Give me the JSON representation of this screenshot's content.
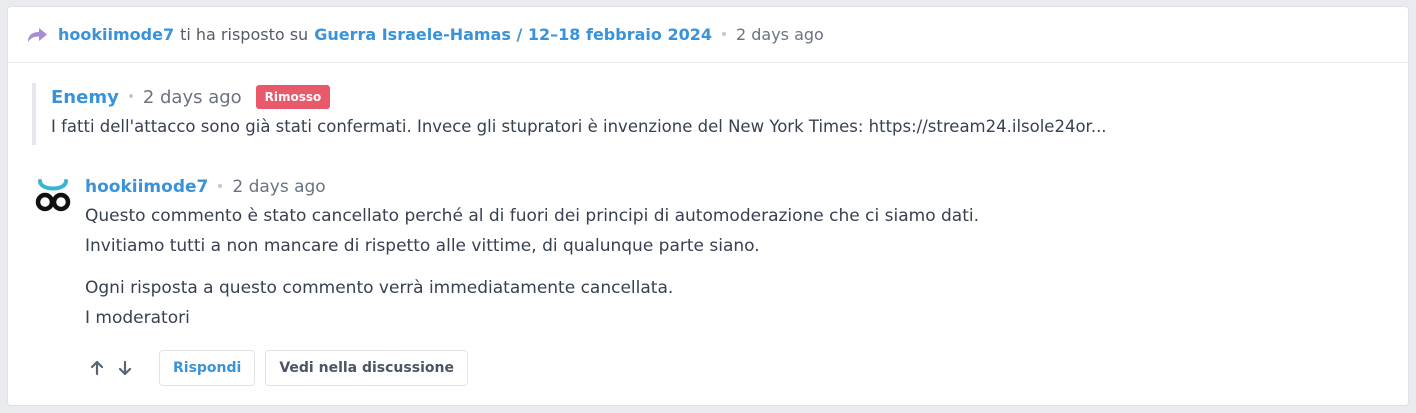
{
  "header": {
    "actor": "hookiimode7",
    "action_text": "ti ha risposto su",
    "thread_title": "Guerra Israele-Hamas / 12–18 febbraio 2024",
    "time": "2 days ago"
  },
  "parent_comment": {
    "author": "Enemy",
    "time": "2 days ago",
    "badge": "Rimosso",
    "text": "I fatti dell'attacco sono già stati confermati. Invece gli stupratori è invenzione del New York Times: https://stream24.ilsole24or..."
  },
  "reply_comment": {
    "author": "hookiimode7",
    "time": "2 days ago",
    "lines": [
      "Questo commento è stato cancellato perché al di fuori dei principi di automoderazione che ci siamo dati.",
      "Invitiamo tutti a non mancare di rispetto alle vittime, di qualunque parte siano.",
      "Ogni risposta a questo commento verrà immediatamente cancellata.",
      "I moderatori"
    ]
  },
  "actions": {
    "reply_label": "Rispondi",
    "context_label": "Vedi nella discussione"
  },
  "colors": {
    "link": "#3a93d8",
    "badge": "#e85a6b",
    "reply_icon": "#a98bd6",
    "avatar_teal": "#3bb4d4"
  },
  "icons": {
    "reply": "reply-arrow-icon",
    "upvote": "arrow-up-icon",
    "downvote": "arrow-down-icon",
    "avatar": "avatar-icon"
  }
}
